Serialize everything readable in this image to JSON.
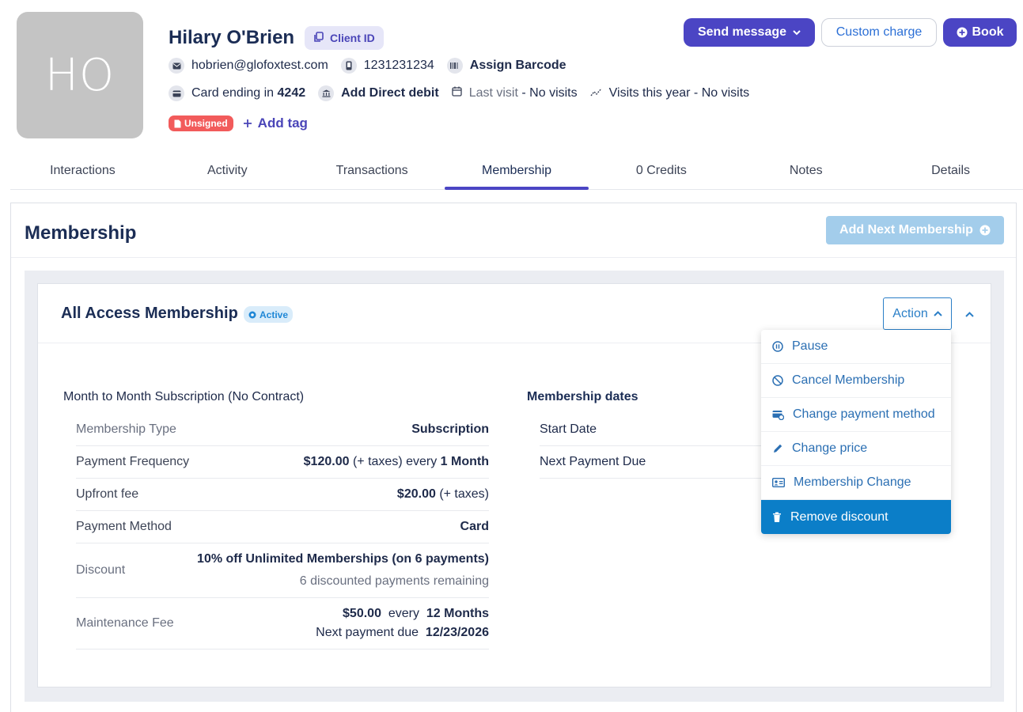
{
  "client": {
    "initials": "HO",
    "name": "Hilary O'Brien",
    "client_id_label": "Client ID",
    "email": "hobrien@glofoxtest.com",
    "phone": "1231231234",
    "assign_barcode": "Assign Barcode",
    "card_prefix": "Card ending in",
    "card_last4": "4242",
    "add_direct_debit": "Add Direct debit",
    "last_visit_label": "Last visit",
    "last_visit_value": "- No visits",
    "visits_year": "Visits this year - No visits",
    "unsigned_badge": "Unsigned",
    "add_tag": "Add tag"
  },
  "header_actions": {
    "send_message": "Send message",
    "custom_charge": "Custom charge",
    "book": "Book"
  },
  "tabs": [
    {
      "label": "Interactions"
    },
    {
      "label": "Activity"
    },
    {
      "label": "Transactions"
    },
    {
      "label": "Membership",
      "active": true
    },
    {
      "label": "0 Credits"
    },
    {
      "label": "Notes"
    },
    {
      "label": "Details"
    }
  ],
  "membership": {
    "title": "Membership",
    "add_next": "Add Next Membership",
    "card": {
      "name": "All Access Membership",
      "status": "Active",
      "action_label": "Action",
      "subscription_title": "Month to Month Subscription (No Contract)",
      "rows": {
        "type_label": "Membership Type",
        "type_value": "Subscription",
        "freq_label": "Payment Frequency",
        "freq_amount": "$120.00",
        "freq_mid": "(+ taxes) every",
        "freq_period": "1 Month",
        "upfront_label": "Upfront fee",
        "upfront_amount": "$20.00",
        "upfront_note": "(+ taxes)",
        "method_label": "Payment Method",
        "method_value": "Card",
        "discount_label": "Discount",
        "discount_value": "10% off Unlimited Memberships (on 6 payments)",
        "discount_remaining": "6 discounted payments remaining",
        "maint_label": "Maintenance Fee",
        "maint_amount": "$50.00",
        "maint_every": "every",
        "maint_period": "12 Months",
        "maint_next_label": "Next payment due",
        "maint_next_date": "12/23/2026"
      },
      "dates_title": "Membership dates",
      "start_date_label": "Start Date",
      "next_payment_label": "Next Payment Due"
    },
    "action_menu": [
      {
        "label": "Pause",
        "icon": "pause-circle-icon"
      },
      {
        "label": "Cancel Membership",
        "icon": "cancel-circle-icon"
      },
      {
        "label": "Change payment method",
        "icon": "card-settings-icon"
      },
      {
        "label": "Change price",
        "icon": "pencil-icon"
      },
      {
        "label": "Membership Change",
        "icon": "id-card-icon"
      },
      {
        "label": "Remove discount",
        "icon": "trash-icon",
        "highlighted": true
      }
    ]
  },
  "colors": {
    "brand": "#4b45c4",
    "link": "#2b7fc7",
    "menu_highlight": "#0b7ec8",
    "unsigned": "#f25b5b"
  }
}
